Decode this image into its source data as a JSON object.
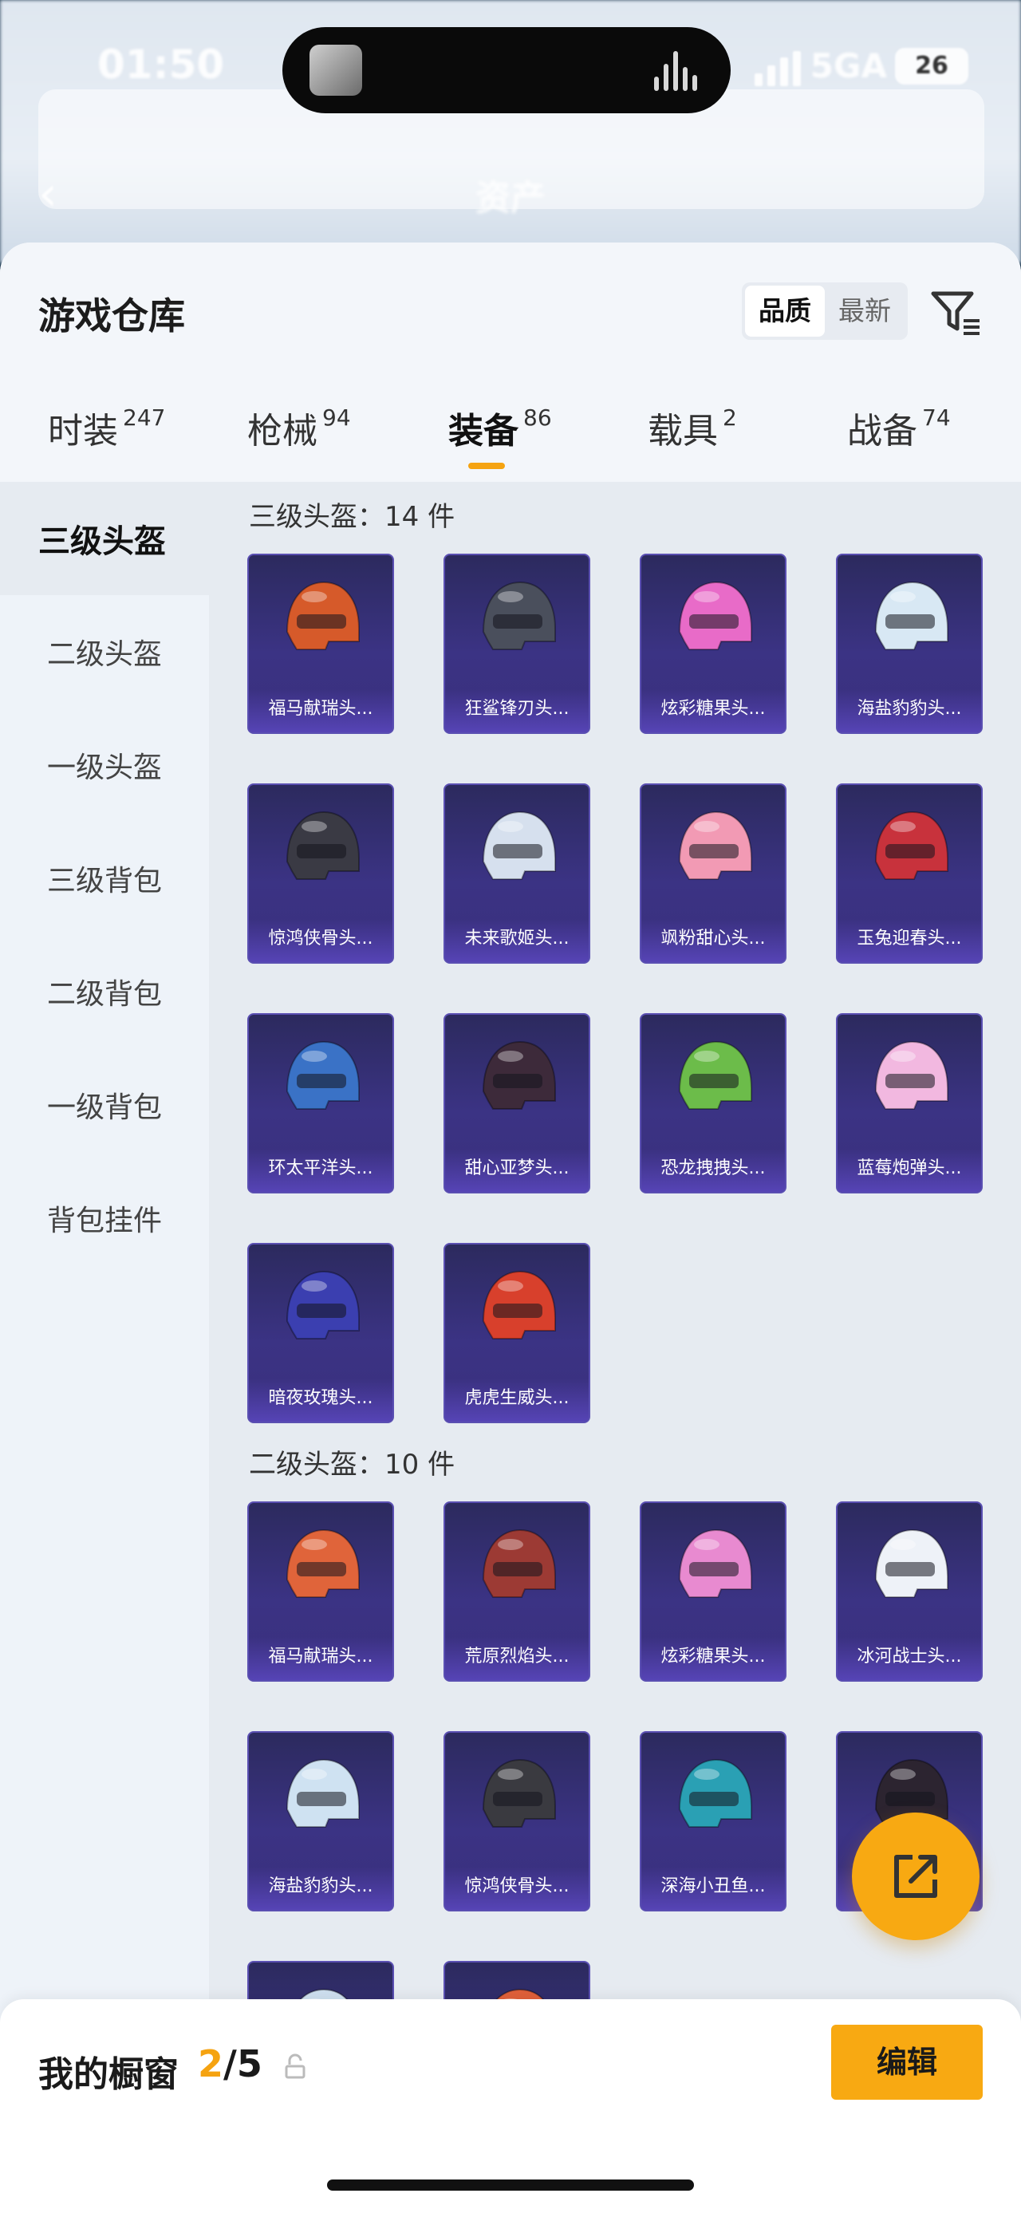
{
  "status": {
    "time": "01:50",
    "network": "5GA",
    "battery": "26"
  },
  "background": {
    "title": "资产",
    "back_icon": "chevron-left-icon"
  },
  "header": {
    "title": "游戏仓库",
    "sort_options": [
      "品质",
      "最新"
    ],
    "active_sort": "品质",
    "filter_icon": "filter-icon"
  },
  "tabs": [
    {
      "label": "时装",
      "count": "247"
    },
    {
      "label": "枪械",
      "count": "94"
    },
    {
      "label": "装备",
      "count": "86"
    },
    {
      "label": "载具",
      "count": "2"
    },
    {
      "label": "战备",
      "count": "74"
    }
  ],
  "active_tab": "装备",
  "sidebar": {
    "items": [
      "三级头盔",
      "二级头盔",
      "一级头盔",
      "三级背包",
      "二级背包",
      "一级背包",
      "背包挂件"
    ],
    "active": "三级头盔"
  },
  "sections": [
    {
      "title": "三级头盔：14 件",
      "items": [
        {
          "name": "福马献瑞头...",
          "color": "#d65a2a"
        },
        {
          "name": "狂鲨锋刃头...",
          "color": "#4a4f5c"
        },
        {
          "name": "炫彩糖果头...",
          "color": "#e86bc8"
        },
        {
          "name": "海盐豹豹头...",
          "color": "#d8e8f4"
        },
        {
          "name": "惊鸿侠骨头...",
          "color": "#3a3a44"
        },
        {
          "name": "未来歌姬头...",
          "color": "#d6e0ee"
        },
        {
          "name": "飒粉甜心头...",
          "color": "#f29ab4"
        },
        {
          "name": "玉兔迎春头...",
          "color": "#c8323c"
        },
        {
          "name": "环太平洋头...",
          "color": "#3a72c6"
        },
        {
          "name": "甜心亚梦头...",
          "color": "#3d2a3a"
        },
        {
          "name": "恐龙拽拽头...",
          "color": "#6cbc4a"
        },
        {
          "name": "蓝莓炮弹头...",
          "color": "#f2b8e0"
        },
        {
          "name": "暗夜玫瑰头...",
          "color": "#3b3fb0"
        },
        {
          "name": "虎虎生威头...",
          "color": "#d8402c"
        }
      ]
    },
    {
      "title": "二级头盔：10 件",
      "items": [
        {
          "name": "福马献瑞头...",
          "color": "#e0643a"
        },
        {
          "name": "荒原烈焰头...",
          "color": "#9c3a34"
        },
        {
          "name": "炫彩糖果头...",
          "color": "#e88ad0"
        },
        {
          "name": "冰河战士头...",
          "color": "#eef2f8"
        },
        {
          "name": "海盐豹豹头...",
          "color": "#cfe2f2"
        },
        {
          "name": "惊鸿侠骨头...",
          "color": "#3a3a40"
        },
        {
          "name": "深海小丑鱼...",
          "color": "#2aa0b4"
        },
        {
          "name": "",
          "color": "#2c2430"
        },
        {
          "name": "",
          "color": "#cfe0f0"
        },
        {
          "name": "",
          "color": "#e0603a"
        }
      ]
    }
  ],
  "share_icon": "share-icon",
  "bottom": {
    "label": "我的橱窗",
    "current": "2",
    "total": "/5",
    "lock_icon": "lock-icon",
    "edit_label": "编辑"
  }
}
